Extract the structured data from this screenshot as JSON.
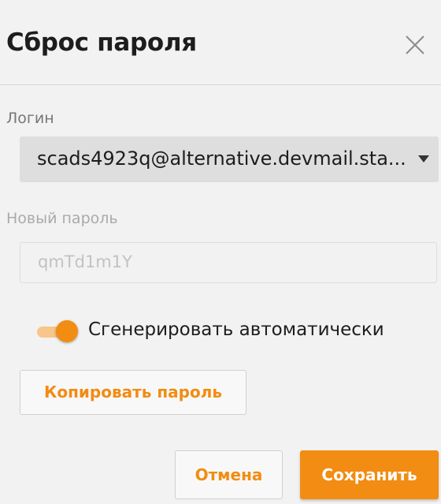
{
  "dialog": {
    "title": "Сброс пароля",
    "close_icon": "close-icon"
  },
  "form": {
    "login_label": "Логин",
    "login_value": "scads4923q@alternative.devmail.sta...",
    "new_password_label": "Новый пароль",
    "new_password_value": "qmTd1m1Y",
    "auto_generate_label": "Сгенерировать автоматически",
    "auto_generate_enabled": true,
    "copy_button_label": "Копировать пароль"
  },
  "footer": {
    "cancel_label": "Отмена",
    "save_label": "Сохранить"
  },
  "colors": {
    "accent": "#f28c12",
    "accent_light": "#f8c58a",
    "background": "#f2f2f2"
  }
}
